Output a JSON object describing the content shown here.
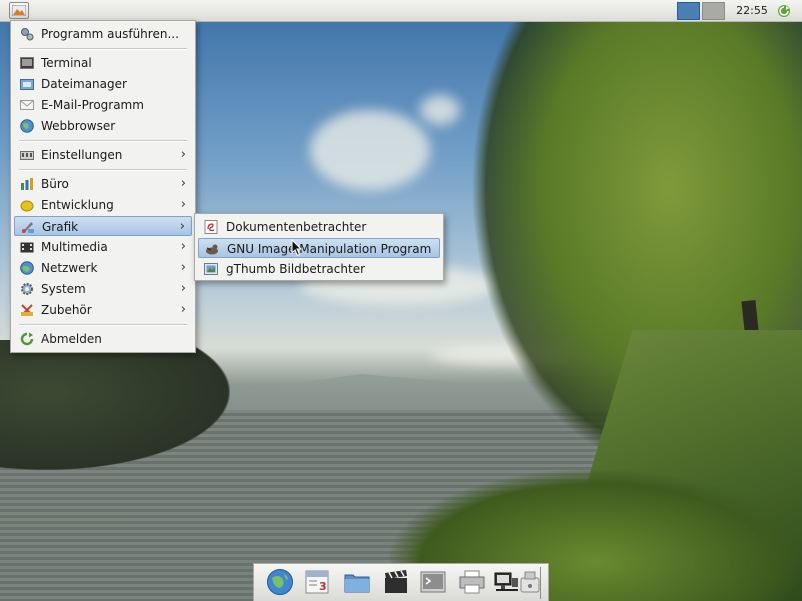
{
  "panel": {
    "clock": "22:55",
    "workspaces": [
      {
        "color": "#4a7fb5"
      },
      {
        "color": "#a9a9a6"
      }
    ]
  },
  "main_menu": {
    "items": [
      {
        "label": "Programm ausführen...",
        "icon": "gears-icon"
      },
      {
        "label": "Terminal",
        "icon": "terminal-icon"
      },
      {
        "label": "Dateimanager",
        "icon": "file-manager-icon"
      },
      {
        "label": "E-Mail-Programm",
        "icon": "envelope-icon"
      },
      {
        "label": "Webbrowser",
        "icon": "globe-icon"
      },
      {
        "label": "Einstellungen",
        "icon": "settings-icon",
        "submenu": true
      },
      {
        "label": "Büro",
        "icon": "office-icon",
        "submenu": true
      },
      {
        "label": "Entwicklung",
        "icon": "development-icon",
        "submenu": true
      },
      {
        "label": "Grafik",
        "icon": "graphics-icon",
        "submenu": true,
        "active": true
      },
      {
        "label": "Multimedia",
        "icon": "multimedia-icon",
        "submenu": true
      },
      {
        "label": "Netzwerk",
        "icon": "network-icon",
        "submenu": true
      },
      {
        "label": "System",
        "icon": "system-icon",
        "submenu": true
      },
      {
        "label": "Zubehör",
        "icon": "accessories-icon",
        "submenu": true
      },
      {
        "label": "Abmelden",
        "icon": "logout-icon"
      }
    ]
  },
  "grafik_submenu": {
    "items": [
      {
        "label": "Dokumentenbetrachter",
        "icon": "document-viewer-icon"
      },
      {
        "label": "GNU Image Manipulation Program",
        "icon": "gimp-icon",
        "active": true
      },
      {
        "label": "gThumb Bildbetrachter",
        "icon": "image-viewer-icon"
      }
    ]
  },
  "dock": {
    "items": [
      "globe-icon",
      "calendar-icon",
      "folder-icon",
      "clapperboard-icon",
      "terminal-icon",
      "printer-icon",
      "network-icon",
      "usb-drive-icon"
    ],
    "calendar_day": "3"
  },
  "colors": {
    "accent": "#4a7fb5",
    "highlight": "#a8c4e4",
    "menu_bg": "#f2f2f0"
  }
}
